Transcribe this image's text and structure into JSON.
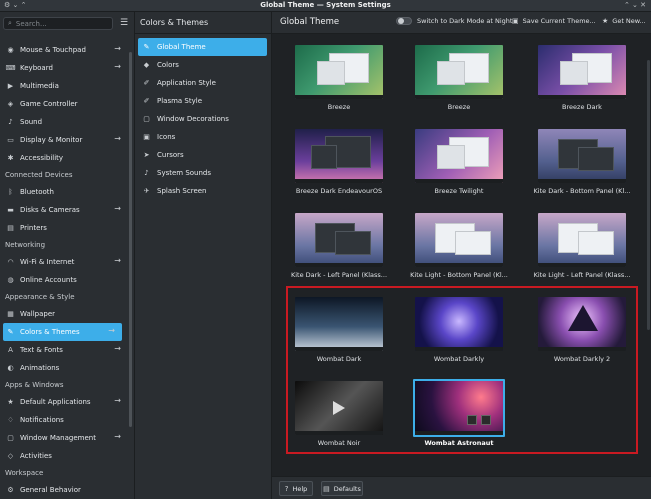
{
  "window": {
    "title": "Global Theme — System Settings"
  },
  "sidebar": {
    "search_placeholder": "Search...",
    "items": [
      {
        "type": "item",
        "label": "Mouse & Touchpad",
        "icon": "mouse-icon",
        "arrow": true
      },
      {
        "type": "item",
        "label": "Keyboard",
        "icon": "keyboard-icon",
        "arrow": true
      },
      {
        "type": "item",
        "label": "Multimedia",
        "icon": "multimedia-icon",
        "arrow": false
      },
      {
        "type": "item",
        "label": "Game Controller",
        "icon": "gamepad-icon",
        "arrow": false
      },
      {
        "type": "item",
        "label": "Sound",
        "icon": "sound-icon",
        "arrow": false
      },
      {
        "type": "item",
        "label": "Display & Monitor",
        "icon": "monitor-icon",
        "arrow": true
      },
      {
        "type": "item",
        "label": "Accessibility",
        "icon": "accessibility-icon",
        "arrow": false
      },
      {
        "type": "section",
        "label": "Connected Devices"
      },
      {
        "type": "item",
        "label": "Bluetooth",
        "icon": "bluetooth-icon",
        "arrow": false
      },
      {
        "type": "item",
        "label": "Disks & Cameras",
        "icon": "disk-icon",
        "arrow": true
      },
      {
        "type": "item",
        "label": "Printers",
        "icon": "printer-icon",
        "arrow": false
      },
      {
        "type": "section",
        "label": "Networking"
      },
      {
        "type": "item",
        "label": "Wi-Fi & Internet",
        "icon": "wifi-icon",
        "arrow": true
      },
      {
        "type": "item",
        "label": "Online Accounts",
        "icon": "accounts-icon",
        "arrow": false
      },
      {
        "type": "section",
        "label": "Appearance & Style"
      },
      {
        "type": "item",
        "label": "Wallpaper",
        "icon": "wallpaper-icon",
        "arrow": false
      },
      {
        "type": "item",
        "label": "Colors & Themes",
        "icon": "brush-icon",
        "arrow": true,
        "selected": true
      },
      {
        "type": "item",
        "label": "Text & Fonts",
        "icon": "font-icon",
        "arrow": true
      },
      {
        "type": "item",
        "label": "Animations",
        "icon": "animation-icon",
        "arrow": false
      },
      {
        "type": "section",
        "label": "Apps & Windows"
      },
      {
        "type": "item",
        "label": "Default Applications",
        "icon": "star-icon",
        "arrow": true
      },
      {
        "type": "item",
        "label": "Notifications",
        "icon": "bell-icon",
        "arrow": false
      },
      {
        "type": "item",
        "label": "Window Management",
        "icon": "window-icon",
        "arrow": true
      },
      {
        "type": "item",
        "label": "Activities",
        "icon": "activities-icon",
        "arrow": false
      },
      {
        "type": "section",
        "label": "Workspace"
      },
      {
        "type": "item",
        "label": "General Behavior",
        "icon": "settings-icon",
        "arrow": false
      }
    ]
  },
  "middle": {
    "title": "Colors & Themes",
    "items": [
      {
        "label": "Global Theme",
        "icon": "brush-icon",
        "selected": true
      },
      {
        "label": "Colors",
        "icon": "palette-icon"
      },
      {
        "label": "Application Style",
        "icon": "pen-icon"
      },
      {
        "label": "Plasma Style",
        "icon": "pen-icon"
      },
      {
        "label": "Window Decorations",
        "icon": "window-icon"
      },
      {
        "label": "Icons",
        "icon": "icons-icon"
      },
      {
        "label": "Cursors",
        "icon": "cursor-icon"
      },
      {
        "label": "System Sounds",
        "icon": "sound-icon"
      },
      {
        "label": "Splash Screen",
        "icon": "rocket-icon"
      }
    ]
  },
  "main": {
    "title": "Global Theme",
    "dark_toggle_label": "Switch to Dark Mode at Night",
    "save_label": "Save Current Theme...",
    "get_new_label": "Get New...",
    "themes": [
      {
        "label": "Breeze",
        "style": "breeze-light"
      },
      {
        "label": "Breeze",
        "style": "breeze-light2"
      },
      {
        "label": "Breeze Dark",
        "style": "breeze-dark"
      },
      {
        "label": "Breeze Dark EndeavourOS",
        "style": "endeavour"
      },
      {
        "label": "Breeze Twilight",
        "style": "twilight"
      },
      {
        "label": "Kite Dark - Bottom Panel (Kl...",
        "style": "kite-dark"
      },
      {
        "label": "Kite Dark - Left Panel (Klass...",
        "style": "kite-dark-left"
      },
      {
        "label": "Kite Light - Bottom Panel (Kl...",
        "style": "kite-light"
      },
      {
        "label": "Kite Light - Left Panel (Klass...",
        "style": "kite-light-left"
      },
      {
        "label": "Wombat Dark",
        "style": "wombat-dark"
      },
      {
        "label": "Wombat Darkly",
        "style": "wombat-darkly"
      },
      {
        "label": "Wombat Darkly 2",
        "style": "wombat-darkly2"
      },
      {
        "label": "Wombat Noir",
        "style": "wombat-noir"
      },
      {
        "label": "Wombat Astronaut",
        "style": "wombat-astronaut",
        "selected": true
      }
    ]
  },
  "footer": {
    "help_label": "Help",
    "defaults_label": "Defaults"
  },
  "colors": {
    "accent": "#3daee9",
    "highlight_box": "#c91a22"
  }
}
